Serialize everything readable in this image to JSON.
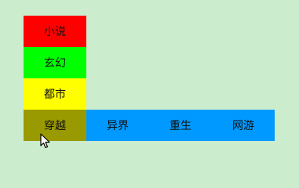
{
  "menu": {
    "items": [
      {
        "label": "小说",
        "color": "#ff0000"
      },
      {
        "label": "玄幻",
        "color": "#00ff00"
      },
      {
        "label": "都市",
        "color": "#ffff00"
      },
      {
        "label": "穿越",
        "color": "#999900"
      }
    ]
  },
  "submenu": {
    "color": "#0099ff",
    "items": [
      {
        "label": "异界"
      },
      {
        "label": "重生"
      },
      {
        "label": "网游"
      }
    ]
  },
  "cursor": {
    "icon": "mouse-pointer-icon"
  }
}
